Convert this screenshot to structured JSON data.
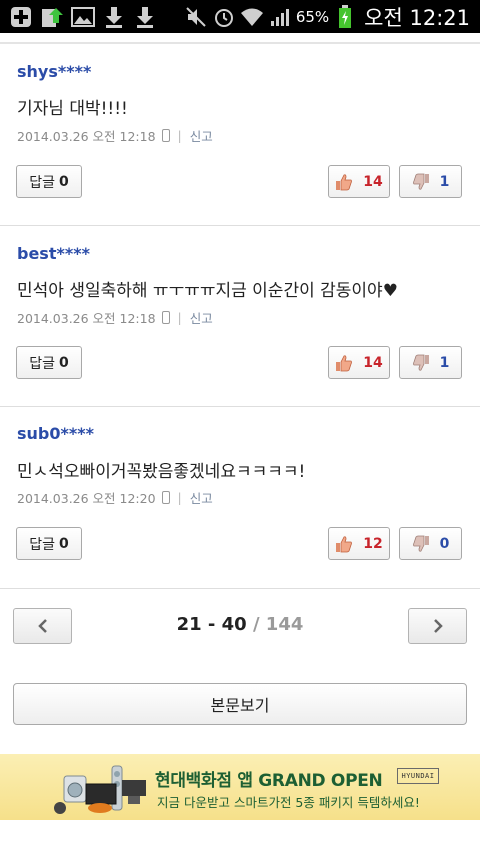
{
  "status_bar": {
    "battery": "65%",
    "clock": "오전 12:21",
    "icons": [
      "plus-icon",
      "upload-icon",
      "image-icon",
      "download-icon",
      "download-icon",
      "mute-icon",
      "alarm-icon",
      "wifi-icon",
      "signal-icon",
      "battery-charging-icon"
    ]
  },
  "comments": [
    {
      "author": "shys****",
      "text": "기자님 대박!!!!",
      "date": "2014.03.26 오전 12:18",
      "report": "신고",
      "reply_label": "답글",
      "reply_count": "0",
      "likes": "14",
      "dislikes": "1"
    },
    {
      "author": "best****",
      "text": "민석아 생일축하해 ㅠㅜㅠㅠ지금 이순간이 감동이야♥",
      "date": "2014.03.26 오전 12:18",
      "report": "신고",
      "reply_label": "답글",
      "reply_count": "0",
      "likes": "14",
      "dislikes": "1"
    },
    {
      "author": "sub0****",
      "text": "민ㅅ석오빠이거꼭봤음좋겠네요ㅋㅋㅋㅋ!",
      "date": "2014.03.26 오전 12:20",
      "report": "신고",
      "reply_label": "답글",
      "reply_count": "0",
      "likes": "12",
      "dislikes": "0"
    }
  ],
  "pagination": {
    "range": "21 - 40",
    "total": " / 144"
  },
  "main_button": "본문보기",
  "ad": {
    "title": "현대백화점 앱 GRAND OPEN",
    "subtitle": "지금 다운받고 스마트가전 5종 패키지 득템하세요!",
    "logo": "HYUNDAI"
  },
  "colors": {
    "author": "#2b4ca8",
    "like": "#c8242b",
    "dislike": "#2b4ca8",
    "ad_text": "#1d5f33"
  }
}
